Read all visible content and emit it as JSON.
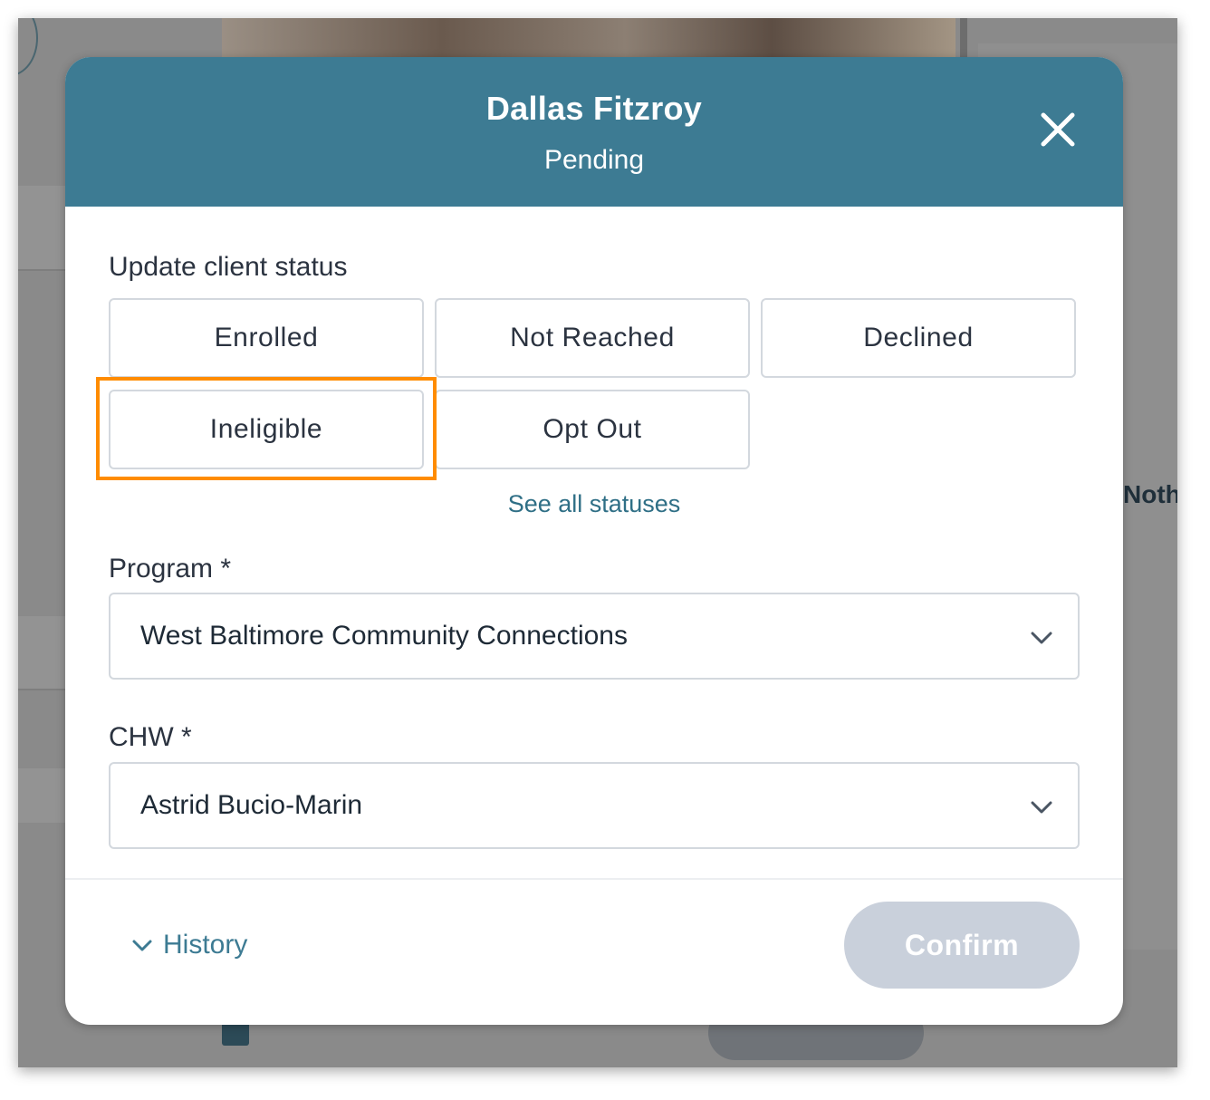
{
  "background": {
    "partial_text": "Noth"
  },
  "modal": {
    "client_name": "Dallas Fitzroy",
    "client_status": "Pending",
    "close_icon": "close-icon",
    "update_label": "Update client status",
    "status_options": [
      {
        "label": "Enrolled"
      },
      {
        "label": "Not Reached"
      },
      {
        "label": "Declined"
      },
      {
        "label": "Ineligible"
      },
      {
        "label": "Opt Out"
      }
    ],
    "highlighted_option": "Ineligible",
    "see_all_link": "See all statuses",
    "program": {
      "label": "Program *",
      "value": "West Baltimore Community Connections"
    },
    "chw": {
      "label": "CHW *",
      "value": "Astrid Bucio-Marin"
    },
    "history_label": "History",
    "confirm_label": "Confirm"
  },
  "colors": {
    "header": "#3d7b93",
    "highlight": "#ff8c00",
    "confirm_disabled": "#c9d0db",
    "link": "#2f6f86"
  }
}
